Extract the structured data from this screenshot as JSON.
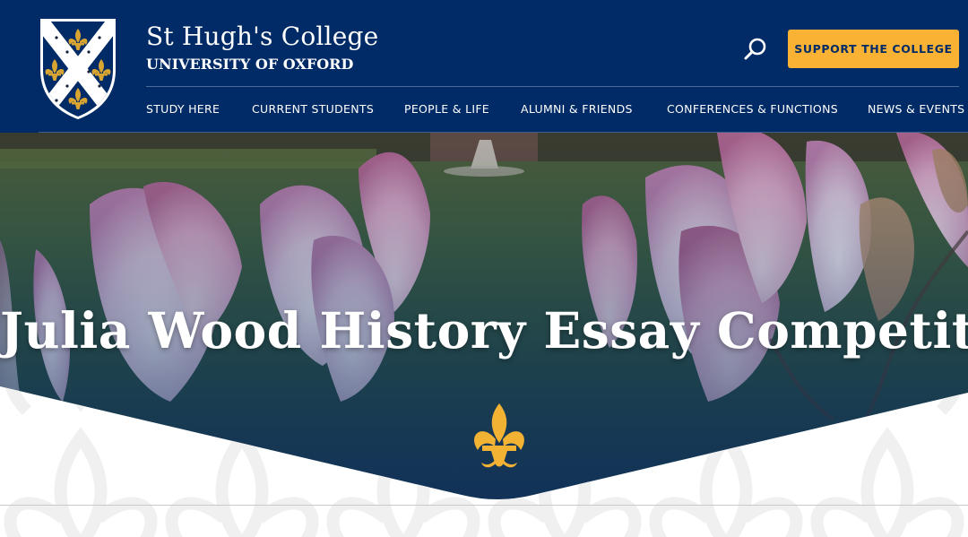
{
  "header": {
    "college_name": "St Hugh's College",
    "university": "UNIVERSITY OF OXFORD",
    "support_label": "SUPPORT THE COLLEGE",
    "search_icon": "search-icon",
    "crest_icon": "college-crest"
  },
  "nav": {
    "items": [
      {
        "label": "STUDY HERE"
      },
      {
        "label": "CURRENT STUDENTS"
      },
      {
        "label": "PEOPLE & LIFE"
      },
      {
        "label": "ALUMNI & FRIENDS"
      },
      {
        "label": "CONFERENCES & FUNCTIONS"
      },
      {
        "label": "NEWS & EVENTS"
      }
    ]
  },
  "hero": {
    "title": "Julia Wood History Essay Competition",
    "emblem_icon": "fleur-de-lis-icon"
  },
  "colors": {
    "brand_navy": "#012b66",
    "accent_gold": "#f9b233",
    "white": "#ffffff"
  }
}
